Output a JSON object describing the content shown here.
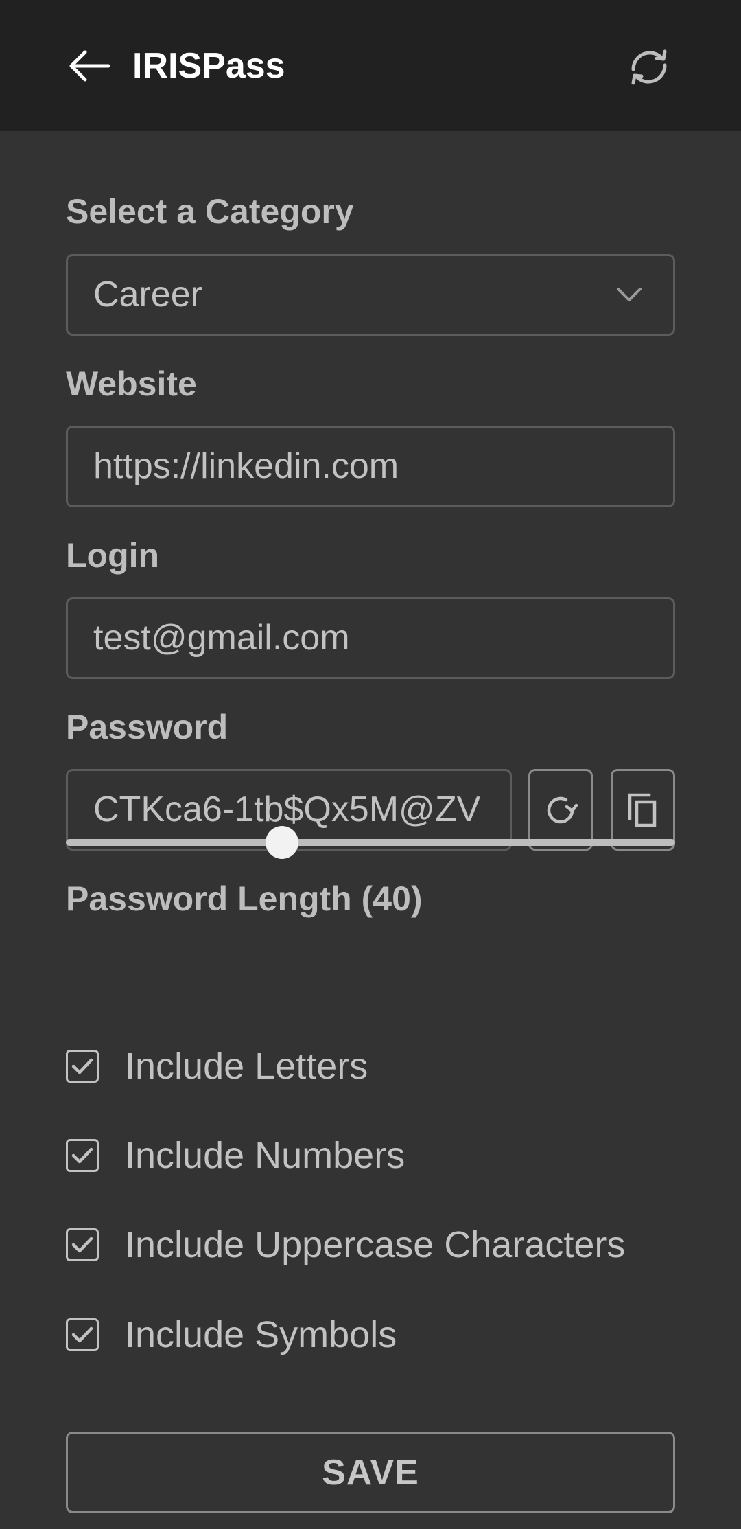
{
  "appbar": {
    "title": "IRISPass",
    "back_icon": "arrow-left-icon",
    "refresh_icon": "sync-icon"
  },
  "category": {
    "label": "Select a Category",
    "selected": "Career",
    "icon": "chevron-down-icon"
  },
  "website": {
    "label": "Website",
    "value": "https://linkedin.com"
  },
  "login": {
    "label": "Login",
    "value": "test@gmail.com"
  },
  "password": {
    "label": "Password",
    "value": "CTKca6-1tb$Qx5M@ZV",
    "regenerate_icon": "rotate-right-icon",
    "copy_icon": "copy-icon"
  },
  "length": {
    "label": "Password Length (40)",
    "value": 40,
    "slider_fraction": 0.355
  },
  "options": [
    {
      "label": "Include Letters",
      "checked": true
    },
    {
      "label": "Include Numbers",
      "checked": true
    },
    {
      "label": "Include Uppercase Characters",
      "checked": true
    },
    {
      "label": "Include Symbols",
      "checked": true
    }
  ],
  "save_label": "SAVE",
  "colors": {
    "appbar_bg": "#212121",
    "page_bg": "#333333",
    "text": "#c2c2c2"
  }
}
